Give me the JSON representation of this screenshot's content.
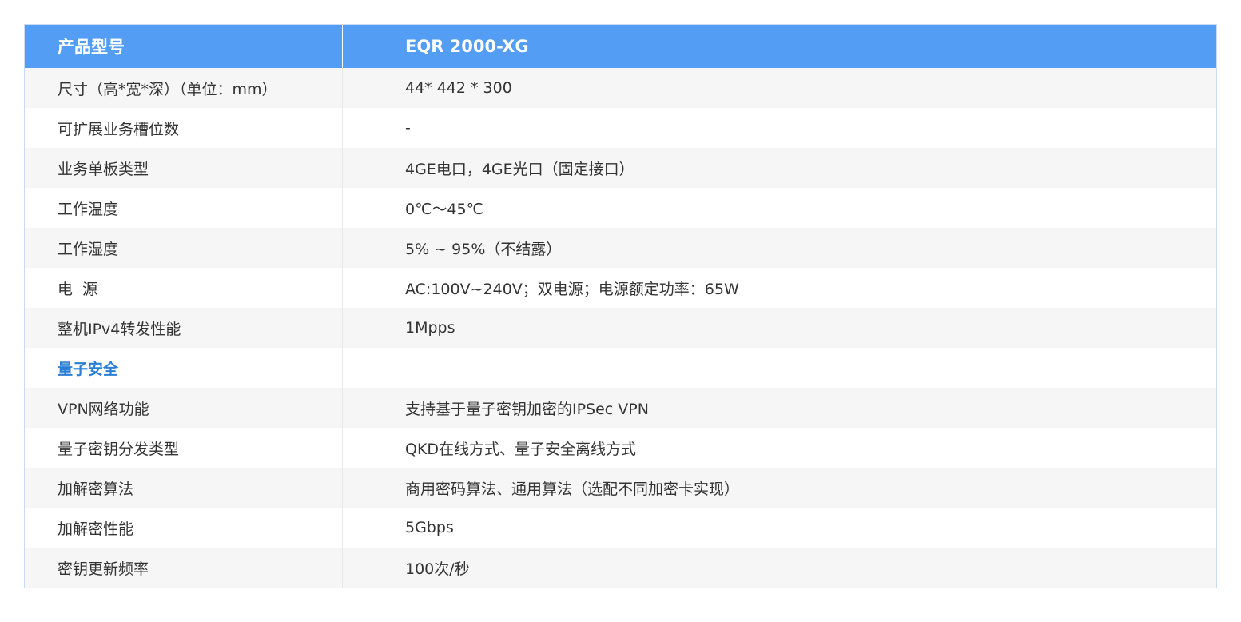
{
  "header": {
    "label": "产品型号",
    "value": "EQR 2000-XG"
  },
  "rows": [
    {
      "label": "尺寸（高*宽*深）（单位：mm）",
      "value": "44* 442 * 300"
    },
    {
      "label": "可扩展业务槽位数",
      "value": "-"
    },
    {
      "label": "业务单板类型",
      "value": "4GE电口，4GE光口（固定接口）"
    },
    {
      "label": "工作温度",
      "value": "0℃～45℃"
    },
    {
      "label": "工作湿度",
      "value": "5% ~ 95%（不结露）"
    },
    {
      "label": "电  源",
      "value": "AC:100V~240V；双电源；电源额定功率：65W"
    },
    {
      "label": "整机IPv4转发性能",
      "value": "1Mpps"
    }
  ],
  "section": {
    "label": "量子安全",
    "value": ""
  },
  "quantum_rows": [
    {
      "label": "VPN网络功能",
      "value": "支持基于量子密钥加密的IPSec VPN"
    },
    {
      "label": "量子密钥分发类型",
      "value": "QKD在线方式、量子安全离线方式"
    },
    {
      "label": "加解密算法",
      "value": "商用密码算法、通用算法（选配不同加密卡实现）"
    },
    {
      "label": "加解密性能",
      "value": "5Gbps"
    },
    {
      "label": "密钥更新频率",
      "value": "100次/秒"
    }
  ],
  "colors": {
    "header_bg": "#539df4",
    "section_text": "#2a7fd4",
    "row_alt_bg": "#f6f6f6"
  }
}
